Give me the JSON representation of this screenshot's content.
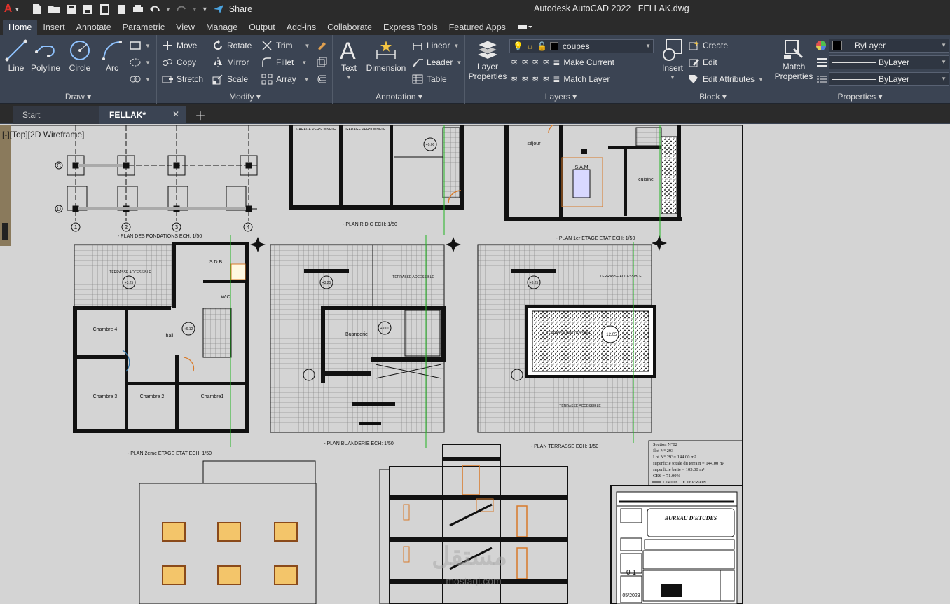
{
  "app": {
    "title": "Autodesk AutoCAD 2022",
    "file": "FELLAK.dwg",
    "logo": "A",
    "share": "Share"
  },
  "ribbon_tabs": [
    "Home",
    "Insert",
    "Annotate",
    "Parametric",
    "View",
    "Manage",
    "Output",
    "Add-ins",
    "Collaborate",
    "Express Tools",
    "Featured Apps"
  ],
  "draw": {
    "line": "Line",
    "polyline": "Polyline",
    "circle": "Circle",
    "arc": "Arc",
    "title": "Draw"
  },
  "modify": {
    "move": "Move",
    "rotate": "Rotate",
    "trim": "Trim",
    "copy": "Copy",
    "mirror": "Mirror",
    "fillet": "Fillet",
    "stretch": "Stretch",
    "scale": "Scale",
    "array": "Array",
    "title": "Modify"
  },
  "annotation": {
    "text": "Text",
    "dimension": "Dimension",
    "linear": "Linear",
    "leader": "Leader",
    "table": "Table",
    "title": "Annotation"
  },
  "layers": {
    "layer_properties_1": "Layer",
    "layer_properties_2": "Properties",
    "current_layer": "coupes",
    "make_current": "Make Current",
    "match_layer": "Match Layer",
    "title": "Layers"
  },
  "block": {
    "insert": "Insert",
    "create": "Create",
    "edit": "Edit",
    "edit_attributes": "Edit Attributes",
    "title": "Block"
  },
  "properties": {
    "match_1": "Match",
    "match_2": "Properties",
    "color": "ByLayer",
    "linetype": "ByLayer",
    "lineweight": "ByLayer",
    "title": "Properties"
  },
  "doc_tabs": {
    "start": "Start",
    "active": "FELLAK*"
  },
  "viewport": {
    "label": "[-][Top][2D Wireframe]"
  },
  "drawing": {
    "plan_fondations": "- PLAN DES FONDATIONS ECH: 1/50",
    "plan_rdc": "- PLAN R.D.C ECH: 1/50",
    "plan_1er": "- PLAN 1er ETAGE ETAT ECH: 1/50",
    "plan_2eme": "- PLAN 2eme ETAGE ETAT ECH: 1/50",
    "plan_buanderie": "- PLAN BUANDERIE ECH: 1/50",
    "plan_terrasse": "- PLAN TERRASSE ECH: 1/50",
    "garage1": "GARAGE PERSONNELE",
    "garage2": "GARAGE PERSONNELE",
    "sejour": "séjour",
    "sam": "S.A.M",
    "cuisine": "cuisine",
    "sdb": "S.D.B",
    "wc": "W.C",
    "hall": "hall",
    "chambre4": "Chambre 4",
    "chambre3": "Chambre 3",
    "chambre2": "Chambre 2",
    "chambre1": "Chambre1",
    "terrasse_acc": "TERRASSE ACCESSIBLE",
    "terrasse_acc2": "TERRASSE ACCESSIBLE",
    "terrasse_acc3": "TERRASSE ACCESSIBLE",
    "terrasse_acc4": "TERRASSE ACCESSIBLE",
    "terrasse_inacc": "TERRASSE INACCESSIBLE",
    "buanderie": "Buanderie",
    "level_000": "+0.00",
    "level_325": "+3.25",
    "level_612": "+6.12",
    "level_901": "+9.01",
    "level_1205": "+12.05",
    "axis_c": "C",
    "axis_d": "D",
    "axis_1": "1",
    "axis_2": "2",
    "axis_3": "3",
    "axis_4": "4",
    "section": "Section N°02",
    "ilot": "Ilot N° 293",
    "lot": "Lot N° 293= 144.00 m²",
    "surf_totale": "superficie totale du terrain = 144.00 m²",
    "surf_batie": "superficie batie = 103.00 m²",
    "ces": "CES = 71.00%",
    "limite": "LIMITE DE TERRAIN",
    "bureau": "BUREAU D'ETUDES",
    "date": "05/2023",
    "planche": "0 1",
    "watermark": "mostaql.com"
  }
}
